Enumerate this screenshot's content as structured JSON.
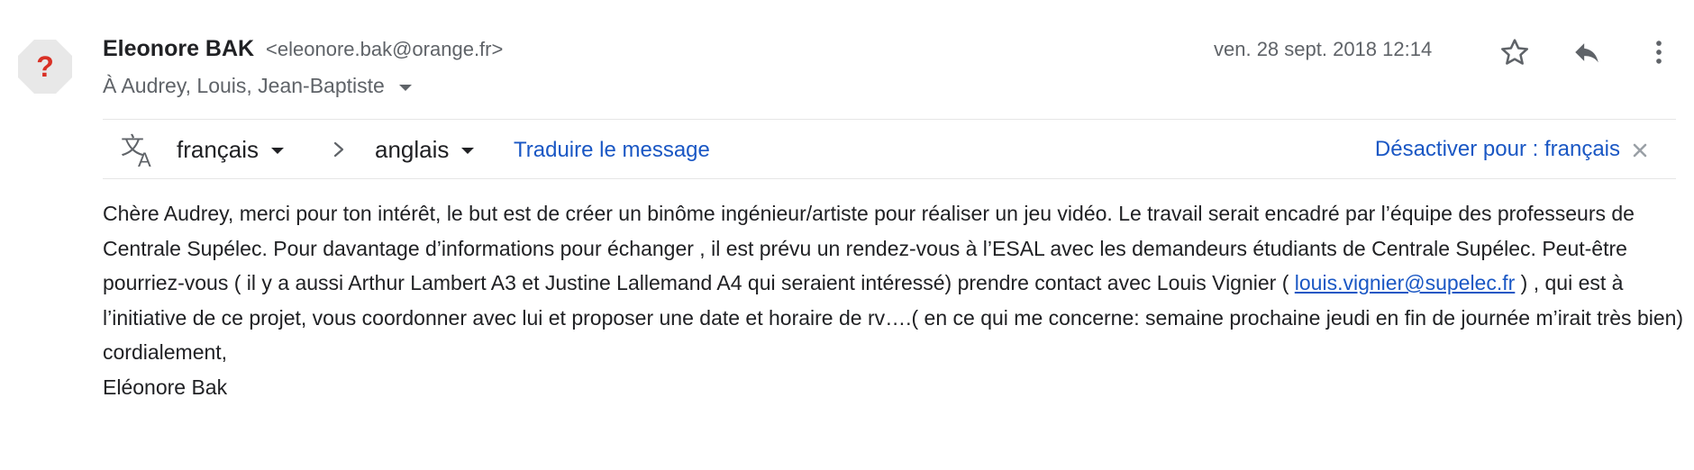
{
  "sender": {
    "avatar_glyph": "?",
    "name": "Eleonore BAK",
    "email": "<eleonore.bak@orange.fr>"
  },
  "recipients": {
    "label": "À Audrey, Louis, Jean-Baptiste",
    "icon": "chevron-down-icon"
  },
  "date": "ven. 28 sept. 2018 12:14",
  "header_actions": {
    "star_icon": "star-icon",
    "reply_icon": "reply-icon",
    "more_icon": "more-vert-icon"
  },
  "translate_bar": {
    "source_lang": "français",
    "target_lang": "anglais",
    "translate_link": "Traduire le message",
    "deactivate_link": "Désactiver pour : français",
    "translate_icon": "translate-icon",
    "close_icon": "close-icon"
  },
  "body": {
    "paragraph_start": "Chère Audrey, merci pour ton intérêt, le but est de créer un binôme ingénieur/artiste pour réaliser un jeu vidéo. Le travail serait encadré par l’équipe des professeurs de Centrale Supélec. Pour davantage d’informations pour échanger , il est prévu un rendez-vous à l’ESAL avec les demandeurs étudiants de Centrale Supélec. Peut-être pourriez-vous ( il y a aussi Arthur Lambert A3 et Justine Lallemand A4 qui seraient intéressé) prendre contact avec Louis Vignier ( ",
    "email_link": "louis.vignier@supelec.fr",
    "paragraph_end": " ) , qui est à l’initiative de ce projet, vous coordonner avec lui  et  proposer une date et horaire  de rv….( en ce qui me concerne: semaine prochaine jeudi en fin de journée m’irait très bien)",
    "closing": "cordialement,",
    "signature": "Eléonore Bak"
  },
  "colors": {
    "link": "#1a57c4",
    "avatar_glyph": "#d93025",
    "avatar_bg": "#e8e8e8",
    "muted_text": "#5f6368"
  }
}
